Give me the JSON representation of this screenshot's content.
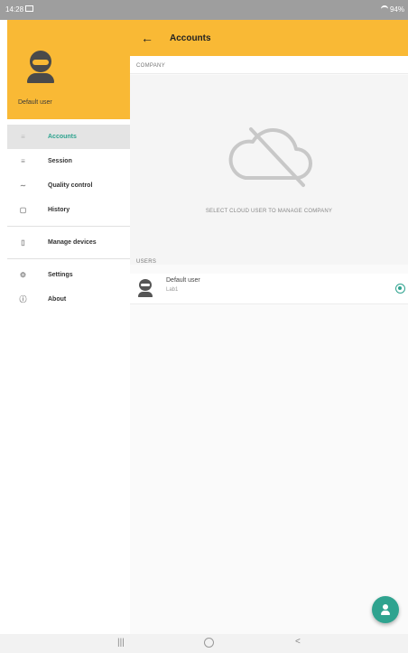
{
  "status_bar": {
    "time": "14:28",
    "right_text": "94%"
  },
  "sidebar": {
    "user_name": "Default user",
    "items": [
      {
        "label": "Accounts",
        "icon": "accounts-icon",
        "active": true
      },
      {
        "label": "Session",
        "icon": "session-list-icon",
        "active": false
      },
      {
        "label": "Quality control",
        "icon": "quality-control-icon",
        "active": false
      },
      {
        "label": "History",
        "icon": "history-icon",
        "active": false
      },
      {
        "label": "Manage devices",
        "icon": "device-icon",
        "active": false
      },
      {
        "label": "Settings",
        "icon": "gear-icon",
        "active": false
      },
      {
        "label": "About",
        "icon": "info-icon",
        "active": false
      }
    ]
  },
  "appbar": {
    "title": "Accounts"
  },
  "company": {
    "section_label": "COMPANY",
    "empty_message": "SELECT CLOUD USER TO MANAGE COMPANY"
  },
  "users": {
    "section_label": "USERS",
    "list": [
      {
        "name": "Default user",
        "subtitle": "Lab1",
        "selected": true
      }
    ]
  },
  "nav": {
    "recent": "|||",
    "back": "<"
  },
  "colors": {
    "primary": "#f9b935",
    "accent": "#2fa38f"
  }
}
